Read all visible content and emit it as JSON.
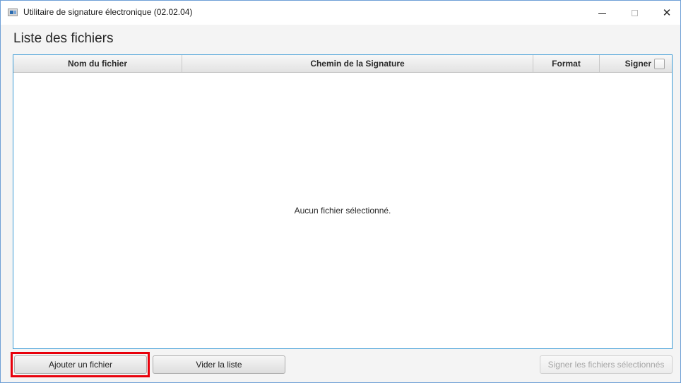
{
  "window": {
    "title": "Utilitaire de signature électronique (02.02.04)",
    "controls": {
      "minimize": "minimize-icon",
      "maximize": "maximize-icon",
      "close": "close-icon"
    }
  },
  "page": {
    "title": "Liste des fichiers"
  },
  "table": {
    "columns": [
      "Nom du fichier",
      "Chemin de la Signature",
      "Format",
      "Signer"
    ],
    "rows": [],
    "empty_message": "Aucun fichier sélectionné.",
    "select_all_checked": false
  },
  "buttons": {
    "add": "Ajouter un fichier",
    "clear": "Vider la liste",
    "sign": "Signer les fichiers sélectionnés",
    "sign_enabled": false
  },
  "highlight": {
    "target": "add-file-button",
    "color": "#e8000b"
  },
  "colors": {
    "table_border": "#3c9bd6",
    "window_border": "#6e9fd6"
  }
}
